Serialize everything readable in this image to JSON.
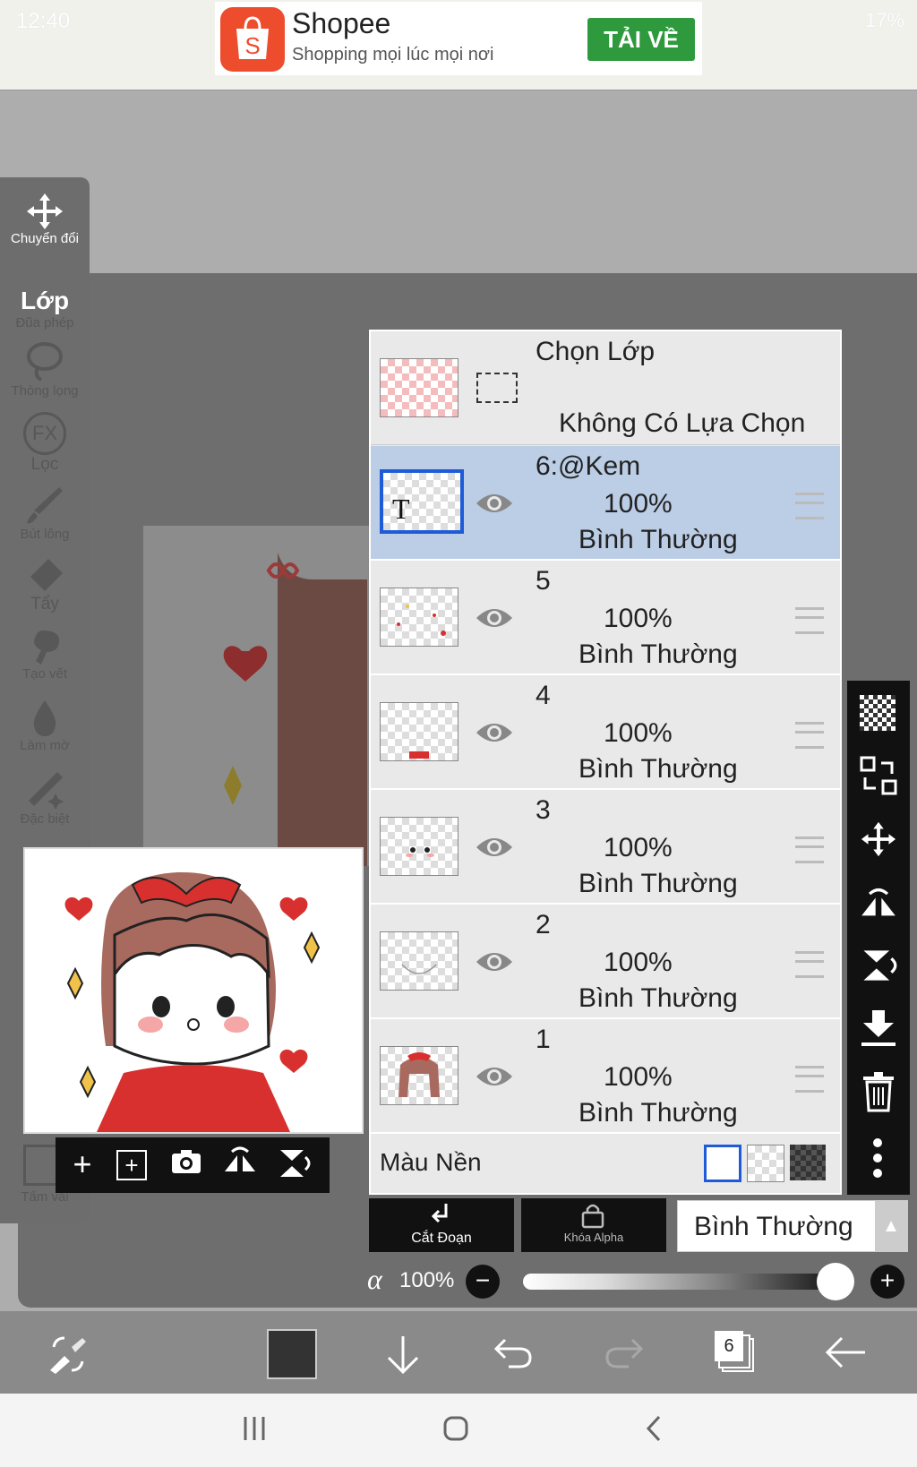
{
  "status_bar": {
    "time": "12:40",
    "battery": "17%"
  },
  "ad": {
    "title": "Shopee",
    "subtitle": "Shopping mọi lúc mọi nơi",
    "button_label": "TẢI VỀ"
  },
  "toolbar": {
    "transform": "Chuyển đổi",
    "layer": "Lớp",
    "magic_wand": "Đũa phép",
    "lasso": "Thòng lọng",
    "filter": "Lọc",
    "brush": "Bút lông",
    "eraser": "Tẩy",
    "smudge": "Tạo vết",
    "blur": "Làm mờ",
    "special": "Đặc biệt",
    "canvas": "Tấm vải"
  },
  "layer_panel": {
    "selection_title": "Chọn Lớp",
    "selection_status": "Không Có Lựa Chọn",
    "layers": [
      {
        "name": "6:@Kem",
        "opacity": "100%",
        "blend": "Bình Thường",
        "active": true,
        "text_layer": true
      },
      {
        "name": "5",
        "opacity": "100%",
        "blend": "Bình Thường",
        "active": false
      },
      {
        "name": "4",
        "opacity": "100%",
        "blend": "Bình Thường",
        "active": false
      },
      {
        "name": "3",
        "opacity": "100%",
        "blend": "Bình Thường",
        "active": false
      },
      {
        "name": "2",
        "opacity": "100%",
        "blend": "Bình Thường",
        "active": false
      },
      {
        "name": "1",
        "opacity": "100%",
        "blend": "Bình Thường",
        "active": false
      }
    ],
    "background_label": "Màu Nền"
  },
  "blend_controls": {
    "clip_label": "Cắt Đoạn",
    "alpha_lock_label": "Khóa Alpha",
    "blend_mode": "Bình Thường",
    "alpha_symbol": "α",
    "alpha_value": "100%",
    "alpha_fraction": 1.0
  },
  "bottom_bar": {
    "layer_count": "6",
    "primary_color": "#333333"
  },
  "colors": {
    "active_layer": "#bccde6",
    "selection_border": "#1f5bd8",
    "ad_button": "#2e9a3d",
    "shopee": "#ee4d2d"
  }
}
